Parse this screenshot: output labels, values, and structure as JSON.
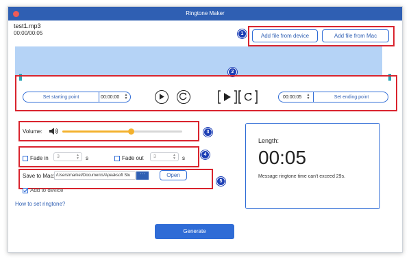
{
  "window": {
    "title": "Ringtone Maker"
  },
  "file": {
    "name": "test1.mp3",
    "time": "00:00/00:05"
  },
  "add_buttons": {
    "device": "Add file from device",
    "mac": "Add file from Mac"
  },
  "annotations": [
    "1",
    "2",
    "3",
    "4",
    "5"
  ],
  "trim": {
    "start_label": "Set starting point",
    "start_time": "00:00:00",
    "end_time": "00:00:05",
    "end_label": "Set ending point"
  },
  "volume": {
    "label": "Volume:",
    "level": 0.57
  },
  "fade": {
    "in_label": "Fade in",
    "in_value": "3",
    "out_label": "Fade out",
    "out_value": "3",
    "unit": "s"
  },
  "save": {
    "label": "Save to Mac:",
    "path": "/Users/market/Documents/Apeaksoft Stu",
    "browse": "···",
    "open": "Open"
  },
  "add_to_device": {
    "label": "Add to device",
    "checked": true
  },
  "help_link": "How to set ringtone?",
  "length_panel": {
    "label": "Length:",
    "value": "00:05",
    "note": "Message ringtone time can't exceed 29s."
  },
  "generate_label": "Generate",
  "colors": {
    "accent": "#2f6cd6",
    "title_bar": "#2f5fb3",
    "waveform": "#b5d3f6",
    "slider": "#f3b12d",
    "annotation_box": "#d9232d"
  }
}
